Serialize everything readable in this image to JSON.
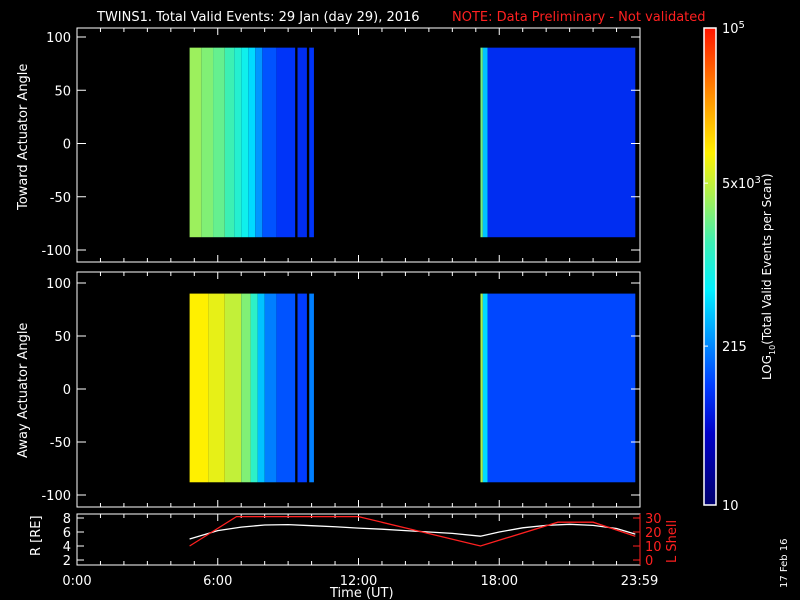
{
  "title": "TWINS1. Total Valid Events: 29 Jan (day  29), 2016",
  "note": "NOTE: Data Preliminary - Not validated",
  "date_stamp": "17 Feb 16",
  "colors": {
    "note": "#ff2020",
    "axis": "#ffffff",
    "lshell": "#ff2020"
  },
  "chart_data": [
    {
      "type": "heatmap",
      "name": "toward",
      "ylabel": "Toward Actuator Angle",
      "ylim": [
        -100,
        100
      ],
      "yticks": [
        "100",
        "50",
        "0",
        "-50",
        "-100"
      ],
      "ytick_values": [
        100,
        50,
        0,
        -50,
        -100
      ],
      "angle_range": [
        -88,
        90
      ],
      "columns_hours_log10": [
        [
          4.8,
          5.3,
          3.55
        ],
        [
          5.3,
          5.8,
          3.45
        ],
        [
          5.8,
          6.3,
          3.35
        ],
        [
          6.3,
          6.7,
          3.2
        ],
        [
          6.7,
          7.0,
          3.05
        ],
        [
          7.0,
          7.3,
          2.9
        ],
        [
          7.3,
          7.6,
          2.7
        ],
        [
          7.6,
          7.9,
          2.4
        ],
        [
          7.9,
          8.5,
          2.1
        ],
        [
          8.5,
          9.3,
          1.95
        ],
        [
          9.4,
          9.8,
          1.9
        ],
        [
          9.9,
          10.1,
          1.95
        ],
        [
          17.2,
          17.3,
          3.4
        ],
        [
          17.3,
          17.5,
          2.6
        ],
        [
          17.5,
          23.8,
          1.9
        ]
      ]
    },
    {
      "type": "heatmap",
      "name": "away",
      "ylabel": "Away Actuator Angle",
      "ylim": [
        -100,
        100
      ],
      "yticks": [
        "100",
        "50",
        "0",
        "-50",
        "-100"
      ],
      "ytick_values": [
        100,
        50,
        0,
        -50,
        -100
      ],
      "angle_range": [
        -88,
        90
      ],
      "columns_hours_log10": [
        [
          4.8,
          5.6,
          3.95
        ],
        [
          5.6,
          6.3,
          3.85
        ],
        [
          6.3,
          7.0,
          3.7
        ],
        [
          7.0,
          7.4,
          3.45
        ],
        [
          7.4,
          7.7,
          3.1
        ],
        [
          7.7,
          8.0,
          2.6
        ],
        [
          8.0,
          8.5,
          2.3
        ],
        [
          8.5,
          9.3,
          2.1
        ],
        [
          9.4,
          9.8,
          2.0
        ],
        [
          9.9,
          10.1,
          2.3
        ],
        [
          17.2,
          17.3,
          3.6
        ],
        [
          17.3,
          17.5,
          2.7
        ],
        [
          17.5,
          23.8,
          2.05
        ]
      ]
    },
    {
      "type": "line",
      "name": "orbit",
      "ylabel": "R [RE]",
      "y2label": "L Shell",
      "xlabel": "Time (UT)",
      "xlim": [
        0,
        24
      ],
      "xticks": [
        "0:00",
        "6:00",
        "12:00",
        "18:00",
        "23:59"
      ],
      "xtick_values": [
        0,
        6,
        12,
        18,
        23.98
      ],
      "ylim": [
        1.8,
        8.2
      ],
      "yticks": [
        "8",
        "6",
        "4",
        "2"
      ],
      "ytick_values": [
        8,
        6,
        4,
        2
      ],
      "y2lim": [
        -2,
        31
      ],
      "y2ticks": [
        "30",
        "20",
        "10",
        "0"
      ],
      "y2tick_values": [
        30,
        20,
        10,
        0
      ],
      "series": [
        {
          "name": "R",
          "x": [
            4.8,
            5.5,
            6.0,
            7.0,
            8.0,
            9.0,
            10.0,
            11.0,
            12.0,
            13.0,
            14.0,
            15.0,
            16.0,
            17.2,
            18.0,
            19.0,
            20.0,
            21.0,
            22.0,
            23.0,
            23.8
          ],
          "y": [
            5.0,
            5.7,
            6.2,
            6.7,
            7.0,
            7.05,
            6.9,
            6.75,
            6.55,
            6.4,
            6.2,
            6.0,
            5.8,
            5.4,
            6.0,
            6.6,
            6.95,
            7.1,
            6.95,
            6.5,
            5.7
          ]
        },
        {
          "name": "L Shell",
          "x": [
            4.8,
            6.8,
            12.0,
            17.2,
            20.5,
            22.0,
            23.8
          ],
          "y": [
            10,
            31,
            31,
            10,
            27,
            27,
            17
          ]
        }
      ]
    },
    {
      "type": "colorbar",
      "label": "LOG10(Total Valid Events per Scan)",
      "label_main": "LOG",
      "label_sub": "10",
      "label_rest": "(Total Valid Events per Scan)",
      "range": [
        10,
        100000
      ],
      "ticks": [
        {
          "label": "10",
          "value": 10
        },
        {
          "label": "215",
          "value": 215
        },
        {
          "label": "5x10",
          "sup": "3",
          "value": 5000
        },
        {
          "label": "10",
          "sup": "5",
          "value": 100000
        }
      ]
    }
  ]
}
